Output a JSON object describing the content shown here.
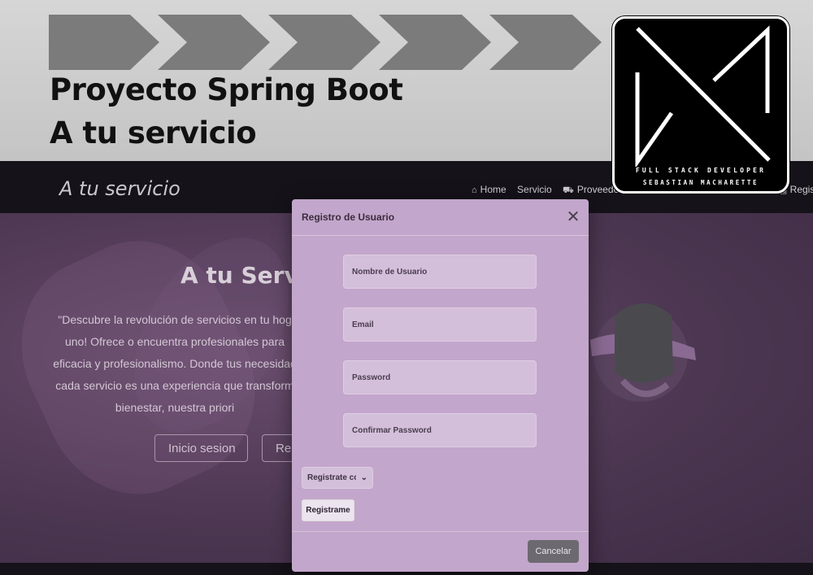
{
  "banner": {
    "title": "Proyecto Spring Boot",
    "subtitle": "A tu servicio",
    "chevron_count": 5
  },
  "logo": {
    "line1": "FULL STACK DEVELOPER",
    "line2": "SEBASTIAN MACHARETTE"
  },
  "site": {
    "brand": "A tu servicio",
    "nav": {
      "home": "Home",
      "servicio": "Servicio",
      "proveedores": "Proveedores",
      "registro": "Regis"
    },
    "hero": {
      "title": "A tu Servici",
      "text_lines": [
        "\"Descubre la revolución de servicios en tu hog",
        "uno! Ofrece o encuentra profesionales para",
        "eficacia y profesionalismo. Donde tus necesidad",
        "cada servicio es una experiencia que transform",
        "bienestar, nuestra priori"
      ],
      "login_button": "Inicio sesion",
      "register_button": "Re"
    }
  },
  "modal": {
    "title": "Registro de Usuario",
    "fields": {
      "username_placeholder": "Nombre de Usuario",
      "email_placeholder": "Email",
      "password_placeholder": "Password",
      "confirm_placeholder": "Confirmar Password"
    },
    "role_select": "Registrate cc",
    "submit": "Registrame",
    "cancel": "Cancelar",
    "close_symbol": "✕"
  },
  "colors": {
    "modal_bg": "#c3a6cb",
    "banner_bg": "#cccccc",
    "chevron": "#7a7a7a",
    "nav_bg": "#151219",
    "cancel_bg": "#6c6a70"
  }
}
